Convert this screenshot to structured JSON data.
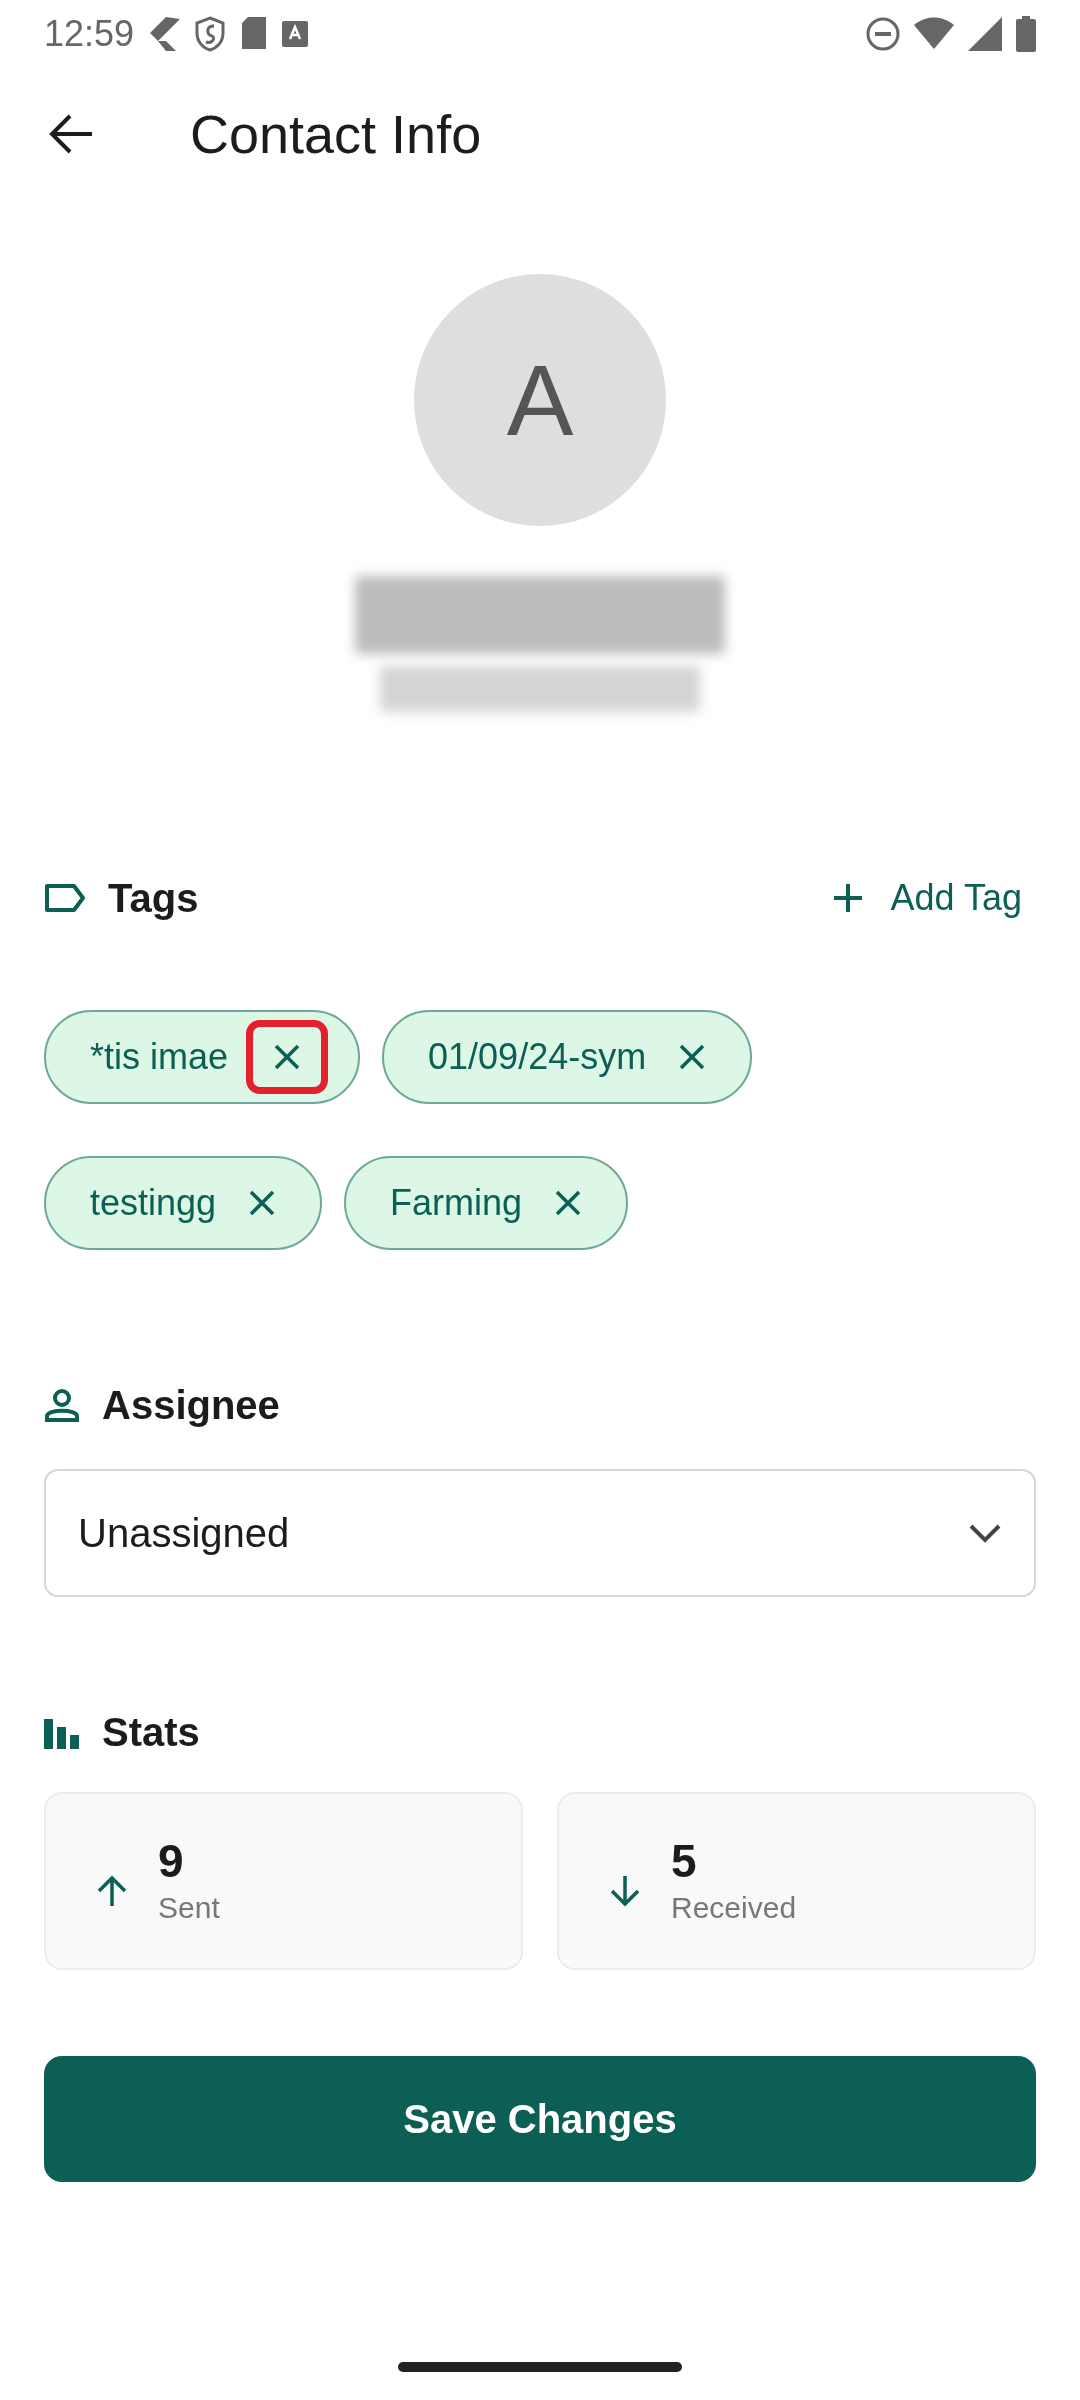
{
  "status_bar": {
    "time": "12:59"
  },
  "app_bar": {
    "title": "Contact Info"
  },
  "contact": {
    "initial": "A",
    "name_blurred": true,
    "phone_blurred": true
  },
  "tags": {
    "title": "Tags",
    "add_label": "Add Tag",
    "items": [
      {
        "label": "*tis imae",
        "highlighted": true
      },
      {
        "label": "01/09/24-sym",
        "highlighted": false
      },
      {
        "label": "testingg",
        "highlighted": false
      },
      {
        "label": "Farming",
        "highlighted": false
      }
    ]
  },
  "assignee": {
    "title": "Assignee",
    "value": "Unassigned"
  },
  "stats": {
    "title": "Stats",
    "items": [
      {
        "kind": "sent",
        "value": "9",
        "label": "Sent"
      },
      {
        "kind": "received",
        "value": "5",
        "label": "Received"
      }
    ]
  },
  "save_button": "Save Changes"
}
